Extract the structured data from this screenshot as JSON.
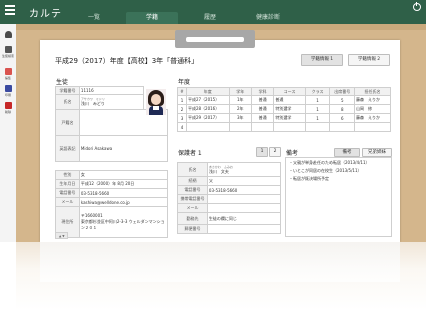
{
  "app": {
    "title": "カルテ"
  },
  "nav": {
    "tabs": [
      "一覧",
      "学籍",
      "履歴",
      "健康診断"
    ],
    "active_index": 1
  },
  "sidebar": {
    "items": [
      "",
      "生徒検索",
      "編集",
      "印刷",
      "削除"
    ]
  },
  "document": {
    "title": "平成29（2017）年度【高校】3年「普通科」",
    "buttons": [
      "学籍情報 1",
      "学籍情報 2"
    ]
  },
  "student": {
    "section_title": "生徒",
    "rows": [
      {
        "label": "学籍番号",
        "value": "11116"
      },
      {
        "label": "氏名",
        "ruby": "アサカワ　ミドリ",
        "value": "浅川　みどり"
      },
      {
        "label": "戸籍名",
        "value": ""
      },
      {
        "label": "英語表記",
        "value": "Midori Asakawa"
      },
      {
        "label": "性別",
        "value": "女"
      },
      {
        "label": "生年月日",
        "value": "平成12（2000）年 8月 20日"
      },
      {
        "label": "電話番号",
        "value": "03-5318-5660"
      },
      {
        "label": "メール",
        "value": "kashiwa@welldone.co.jp"
      },
      {
        "label": "現住所",
        "value": "〒1660001\n東京都杉並区中阿川2-3-3 ウェルダンマンション２０１"
      }
    ]
  },
  "history": {
    "section_title": "年度",
    "headers": [
      "#",
      "年度",
      "学年",
      "学科",
      "コース",
      "クラス",
      "出席番号",
      "担任氏名"
    ],
    "rows": [
      [
        "1",
        "平成27（2015）",
        "1年",
        "普通",
        "普通",
        "1",
        "5",
        "藤森　えりか"
      ],
      [
        "2",
        "平成28（2016）",
        "2年",
        "普通",
        "特別選学",
        "1",
        "8",
        "山岡　修"
      ],
      [
        "3",
        "平成29（2017）",
        "3年",
        "普通",
        "特別選学",
        "1",
        "6",
        "藤森　えりか"
      ],
      [
        "4",
        "",
        "",
        "",
        "",
        "",
        "",
        ""
      ]
    ]
  },
  "guardian": {
    "section_title": "保護者 1",
    "pages": [
      "1",
      "2"
    ],
    "rows": [
      {
        "label": "氏名",
        "ruby": "あさかわ　ふみお",
        "value": "浅川　文夫"
      },
      {
        "label": "続柄",
        "value": "父"
      },
      {
        "label": "電話番号",
        "value": "03-5318-5660"
      },
      {
        "label": "携帯電話番号",
        "value": ""
      },
      {
        "label": "メール",
        "value": ""
      },
      {
        "label": "勤務先",
        "value": "生徒の欄に同じ"
      },
      {
        "label": "郵便番号",
        "value": ""
      }
    ]
  },
  "notes": {
    "section_title": "備考",
    "buttons": [
      "備考",
      "兄弟姉妹"
    ],
    "lines": [
      "・父親が単身赴任のため転居（2013/4/11）",
      "・いとこが同居の在校生（2013/5/11）",
      "・転居が既決場所予定"
    ]
  },
  "scroll_indicator": "▲ ▼"
}
